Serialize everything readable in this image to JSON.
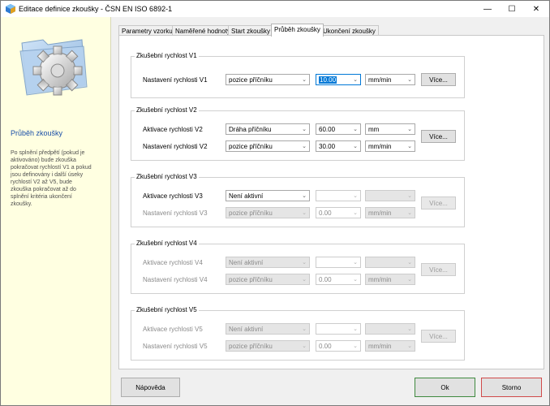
{
  "window": {
    "title": "Editace definice zkoušky - ČSN EN ISO 6892-1"
  },
  "sidebar": {
    "title": "Průběh zkoušky",
    "description_lines": [
      "Po splnění předpětí (pokud je",
      "aktivováno) bude zkouška",
      "pokračovat rychlostí V1 a pokud",
      "jsou definovány i další úseky",
      "rychlostí V2 až V5, bude",
      "zkouška pokračovat až do",
      "splnění kritéria ukončení",
      "zkoušky."
    ]
  },
  "tabs": [
    {
      "label": "Parametry vzorku",
      "active": false
    },
    {
      "label": "Naměřené hodnoty",
      "active": false
    },
    {
      "label": "Start zkoušky",
      "active": false
    },
    {
      "label": "Průběh zkoušky",
      "active": true
    },
    {
      "label": "Ukončení zkoušky",
      "active": false
    }
  ],
  "groups": [
    {
      "title": "Zkušební rychlost V1",
      "rows": [
        {
          "label": "Nastavení rychlosti V1",
          "mode": "pozice příčníku",
          "value": "10.00",
          "unit": "mm/min",
          "enabled": true,
          "selected": true
        }
      ],
      "more": "Více...",
      "more_enabled": true
    },
    {
      "title": "Zkušební rychlost V2",
      "rows": [
        {
          "label": "Aktivace rychlosti V2",
          "mode": "Dráha příčníku",
          "value": "60.00",
          "unit": "mm",
          "enabled": true
        },
        {
          "label": "Nastavení rychlosti V2",
          "mode": "pozice příčníku",
          "value": "30.00",
          "unit": "mm/min",
          "enabled": true
        }
      ],
      "more": "Více...",
      "more_enabled": true
    },
    {
      "title": "Zkušební rychlost V3",
      "rows": [
        {
          "label": "Aktivace rychlosti V3",
          "mode": "Není aktivní",
          "value": "",
          "unit": "",
          "enabled": true,
          "partial": true
        },
        {
          "label": "Nastavení rychlosti V3",
          "mode": "pozice příčníku",
          "value": "0.00",
          "unit": "mm/min",
          "enabled": false
        }
      ],
      "more": "Více...",
      "more_enabled": false
    },
    {
      "title": "Zkušební rychlost V4",
      "rows": [
        {
          "label": "Aktivace rychlosti V4",
          "mode": "Není aktivní",
          "value": "",
          "unit": "",
          "enabled": false
        },
        {
          "label": "Nastavení rychlosti V4",
          "mode": "pozice příčníku",
          "value": "0.00",
          "unit": "mm/min",
          "enabled": false
        }
      ],
      "more": "Více...",
      "more_enabled": false
    },
    {
      "title": "Zkušební rychlost V5",
      "rows": [
        {
          "label": "Aktivace rychlosti V5",
          "mode": "Není aktivní",
          "value": "",
          "unit": "",
          "enabled": false
        },
        {
          "label": "Nastavení rychlosti V5",
          "mode": "pozice příčníku",
          "value": "0.00",
          "unit": "mm/min",
          "enabled": false
        }
      ],
      "more": "Více...",
      "more_enabled": false
    }
  ],
  "footer": {
    "help": "Nápověda",
    "ok": "Ok",
    "cancel": "Storno"
  },
  "colors": {
    "sidebar_bg": "#ffffe1",
    "accent": "#0078d7",
    "ok_border": "#3f8a3f",
    "cancel_border": "#d04a4a"
  }
}
